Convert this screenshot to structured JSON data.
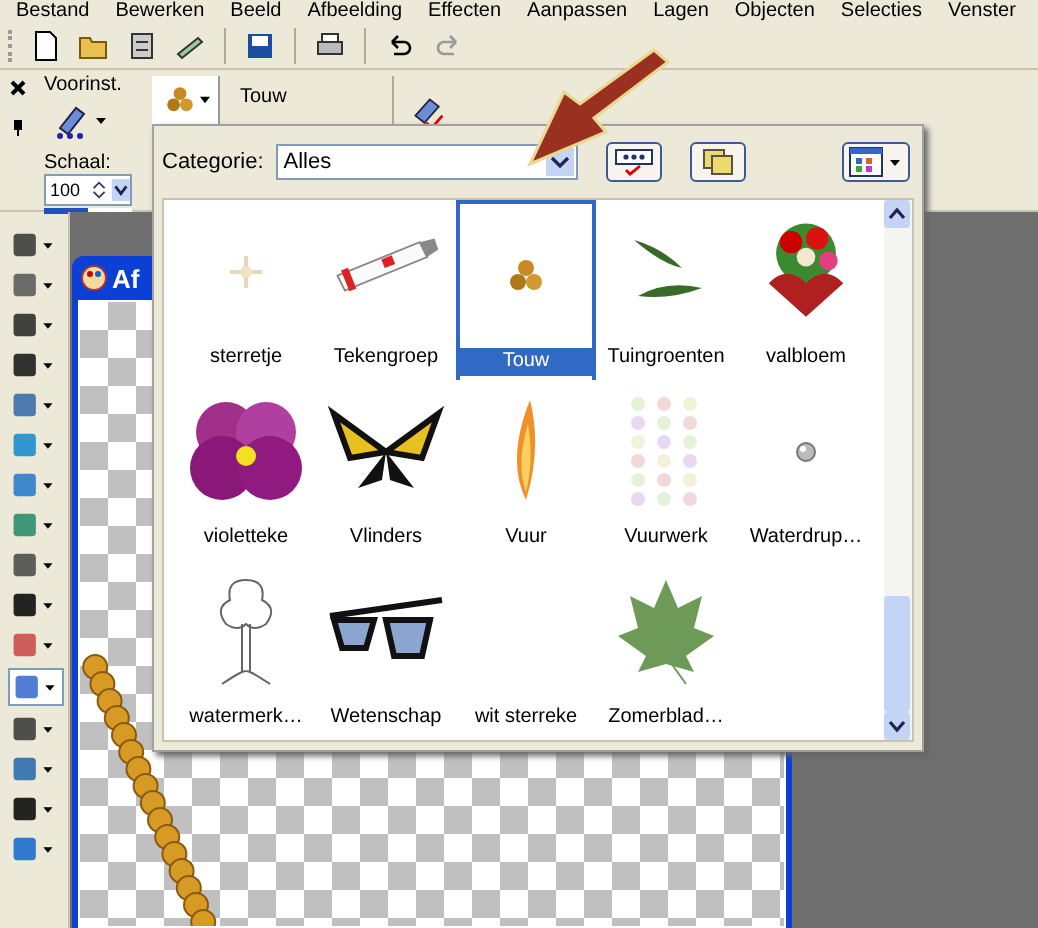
{
  "menu": [
    "Bestand",
    "Bewerken",
    "Beeld",
    "Afbeelding",
    "Effecten",
    "Aanpassen",
    "Lagen",
    "Objecten",
    "Selecties",
    "Venster"
  ],
  "tool_options": {
    "preset_label": "Voorinst.",
    "tube_name": "Touw",
    "scale": {
      "label": "Schaal:",
      "value": "100",
      "level": 0.5
    }
  },
  "canvas_window": {
    "title": "Af"
  },
  "picker": {
    "category_label": "Categorie:",
    "category_value": "Alles",
    "items": [
      {
        "name": "sterretje",
        "kind": "sparkle",
        "selected": false
      },
      {
        "name": "Tekengroep",
        "kind": "paint-tube",
        "selected": false
      },
      {
        "name": "Touw",
        "kind": "beads",
        "selected": true
      },
      {
        "name": "Tuingroenten",
        "kind": "pea-pods",
        "selected": false
      },
      {
        "name": "valbloem",
        "kind": "bouquet",
        "selected": false
      },
      {
        "name": "violetteke",
        "kind": "pansy",
        "selected": false
      },
      {
        "name": "Vlinders",
        "kind": "butterfly",
        "selected": false
      },
      {
        "name": "Vuur",
        "kind": "flame",
        "selected": false
      },
      {
        "name": "Vuurwerk",
        "kind": "fireworks",
        "selected": false
      },
      {
        "name": "Waterdrup…",
        "kind": "droplet",
        "selected": false
      },
      {
        "name": "watermerk…",
        "kind": "tree",
        "selected": false
      },
      {
        "name": "Wetenschap",
        "kind": "sunglasses",
        "selected": false
      },
      {
        "name": "wit sterreke",
        "kind": "blank",
        "selected": false
      },
      {
        "name": "Zomerblad…",
        "kind": "leaf",
        "selected": false
      }
    ]
  }
}
